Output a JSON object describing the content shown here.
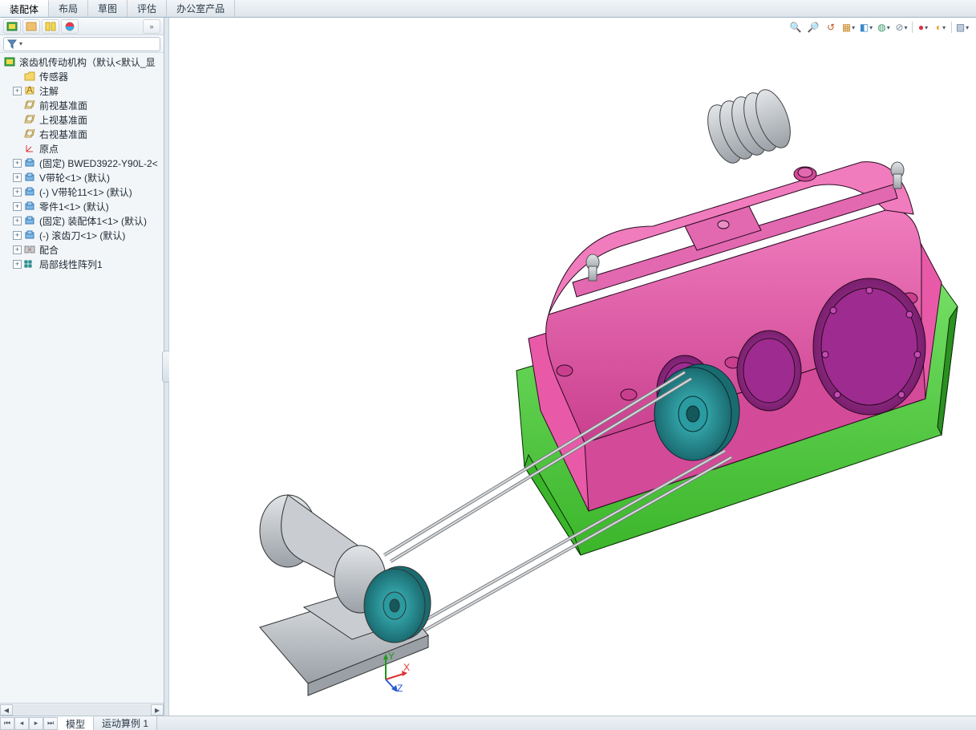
{
  "topTabs": {
    "items": [
      {
        "label": "装配体",
        "active": true
      },
      {
        "label": "布局",
        "active": false
      },
      {
        "label": "草图",
        "active": false
      },
      {
        "label": "评估",
        "active": false
      },
      {
        "label": "办公室产品",
        "active": false
      }
    ]
  },
  "sidebar": {
    "filterPlaceholder": "",
    "tree": {
      "root": {
        "label": "滚齿机传动机构（默认<默认_显"
      },
      "items": [
        {
          "icon": "sensor",
          "label": "传感器"
        },
        {
          "icon": "annot",
          "label": "注解",
          "exp": "+"
        },
        {
          "icon": "plane",
          "label": "前视基准面"
        },
        {
          "icon": "plane",
          "label": "上视基准面"
        },
        {
          "icon": "plane",
          "label": "右视基准面"
        },
        {
          "icon": "origin",
          "label": "原点"
        },
        {
          "icon": "part",
          "label": "(固定) BWED3922-Y90L-2<",
          "exp": "+"
        },
        {
          "icon": "part",
          "label": "V带轮<1> (默认)",
          "exp": "+"
        },
        {
          "icon": "part",
          "label": "(-) V带轮11<1> (默认)",
          "exp": "+"
        },
        {
          "icon": "part",
          "label": "零件1<1> (默认)",
          "exp": "+"
        },
        {
          "icon": "part",
          "label": "(固定) 装配体1<1> (默认)",
          "exp": "+"
        },
        {
          "icon": "part",
          "label": "(-) 滚齿刀<1> (默认)",
          "exp": "+"
        },
        {
          "icon": "mate",
          "label": "配合",
          "exp": "+"
        },
        {
          "icon": "pattern",
          "label": "局部线性阵列1",
          "exp": "+"
        }
      ]
    }
  },
  "viewTools": [
    {
      "name": "zoom-fit-icon",
      "glyph": "🔍"
    },
    {
      "name": "zoom-area-icon",
      "glyph": "🔎"
    },
    {
      "name": "prev-view-icon",
      "glyph": "↺"
    },
    {
      "name": "section-icon",
      "glyph": "▦",
      "dd": true
    },
    {
      "name": "view-orient-icon",
      "glyph": "◧",
      "dd": true
    },
    {
      "name": "display-style-icon",
      "glyph": "◍",
      "dd": true
    },
    {
      "name": "hide-show-icon",
      "glyph": "⊘",
      "dd": true
    },
    {
      "name": "appearance-icon",
      "glyph": "●",
      "dd": true
    },
    {
      "name": "scene-icon",
      "glyph": "◐",
      "dd": true
    },
    {
      "name": "settings-icon",
      "glyph": "▨",
      "dd": true
    }
  ],
  "bottomTabs": {
    "items": [
      {
        "label": "模型",
        "active": true
      },
      {
        "label": "运动算例 1",
        "active": false
      }
    ]
  },
  "triad": {
    "x": "X",
    "y": "Y",
    "z": "Z"
  },
  "colors": {
    "gearboxTop": "#e85aa8",
    "gearboxTopL": "#f07cbd",
    "gearboxTopD": "#c93f8e",
    "gearboxBase": "#4fd63f",
    "gearboxBaseL": "#7ae36b",
    "endcap": "#9e2b8f",
    "pulley": "#2a9ba0",
    "pulleyL": "#3fc0c5",
    "metal": "#c9ccd0",
    "metalD": "#9aa0a6",
    "metalL": "#e2e5e8",
    "belt": "#d7dadd"
  }
}
